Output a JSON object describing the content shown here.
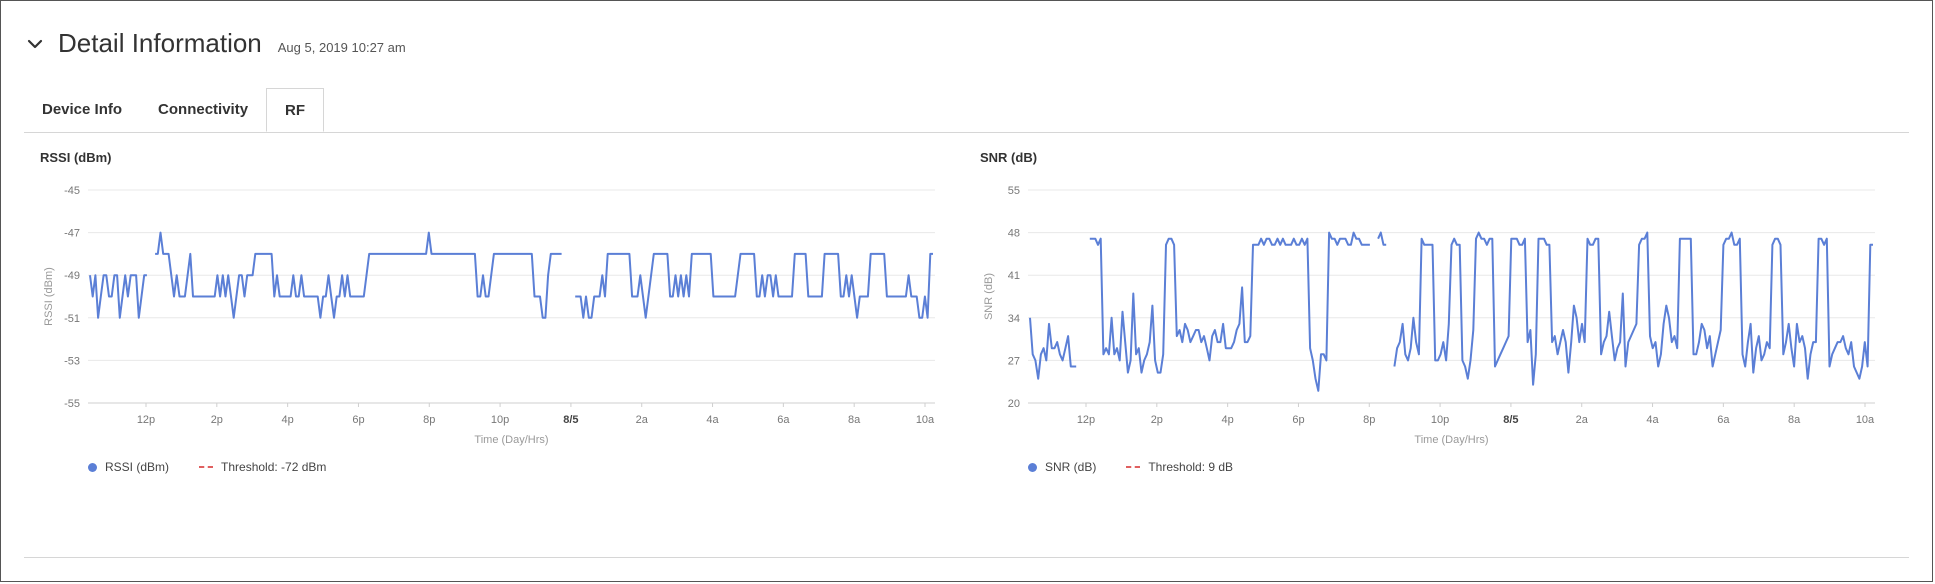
{
  "header": {
    "title": "Detail Information",
    "timestamp": "Aug 5, 2019 10:27 am"
  },
  "tabs": [
    {
      "label": "Device Info",
      "active": false
    },
    {
      "label": "Connectivity",
      "active": false
    },
    {
      "label": "RF",
      "active": true
    }
  ],
  "colors": {
    "series": "#5b7fd6",
    "threshold": "#e06060",
    "grid": "#e8e8e8"
  },
  "chart_data": [
    {
      "type": "line",
      "title": "RSSI (dBm)",
      "ylabel": "RSSI (dBm)",
      "xlabel": "Time (Day/Hrs)",
      "ylim": [
        -55,
        -45
      ],
      "yticks": [
        "-45",
        "-47",
        "-49",
        "-51",
        "-53",
        "-55"
      ],
      "xticks": [
        "12p",
        "2p",
        "4p",
        "6p",
        "8p",
        "10p",
        "8/5",
        "2a",
        "4a",
        "6a",
        "8a",
        "10a"
      ],
      "xticks_bold": [
        "8/5"
      ],
      "legend": {
        "series": "RSSI (dBm)",
        "threshold": "Threshold: -72 dBm"
      },
      "series": [
        {
          "name": "RSSI (dBm)",
          "values": [
            -49,
            -50,
            -49,
            -51,
            -50,
            -49,
            -49,
            -50,
            -50,
            -49,
            -49,
            -51,
            -50,
            -49,
            -50,
            -49,
            -49,
            -49,
            -51,
            -50,
            -49,
            -49,
            null,
            null,
            -48,
            -48,
            -47,
            -48,
            -48,
            -48,
            -49,
            -50,
            -49,
            -50,
            -50,
            -50,
            -49,
            -48,
            -50,
            -50,
            -50,
            -50,
            -50,
            -50,
            -50,
            -50,
            -50,
            -49,
            -50,
            -49,
            -50,
            -49,
            -50,
            -51,
            -50,
            -49,
            -49,
            -50,
            -49,
            -49,
            -49,
            -48,
            -48,
            -48,
            -48,
            -48,
            -48,
            -48,
            -50,
            -49,
            -50,
            -50,
            -50,
            -50,
            -50,
            -49,
            -50,
            -50,
            -49,
            -50,
            -50,
            -50,
            -50,
            -50,
            -50,
            -51,
            -50,
            -50,
            -49,
            -50,
            -51,
            -50,
            -50,
            -49,
            -50,
            -49,
            -50,
            -50,
            -50,
            -50,
            -50,
            -50,
            -49,
            -48,
            -48,
            -48,
            -48,
            -48,
            -48,
            -48,
            -48,
            -48,
            -48,
            -48,
            -48,
            -48,
            -48,
            -48,
            -48,
            -48,
            -48,
            -48,
            -48,
            -48,
            -48,
            -47,
            -48,
            -48,
            -48,
            -48,
            -48,
            -48,
            -48,
            -48,
            -48,
            -48,
            -48,
            -48,
            -48,
            -48,
            -48,
            -48,
            -48,
            -50,
            -50,
            -49,
            -50,
            -50,
            -49,
            -48,
            -48,
            -48,
            -48,
            -48,
            -48,
            -48,
            -48,
            -48,
            -48,
            -48,
            -48,
            -48,
            -48,
            -48,
            -50,
            -50,
            -50,
            -51,
            -51,
            -49,
            -48,
            -48,
            -48,
            -48,
            -48,
            null,
            null,
            null,
            null,
            -50,
            -50,
            -50,
            -51,
            -50,
            -51,
            -51,
            -50,
            -50,
            -50,
            -49,
            -50,
            -48,
            -48,
            -48,
            -48,
            -48,
            -48,
            -48,
            -48,
            -48,
            -50,
            -50,
            -50,
            -49,
            -50,
            -51,
            -50,
            -49,
            -48,
            -48,
            -48,
            -48,
            -48,
            -48,
            -50,
            -50,
            -49,
            -50,
            -49,
            -50,
            -49,
            -50,
            -48,
            -48,
            -48,
            -48,
            -48,
            -48,
            -48,
            -48,
            -50,
            -50,
            -50,
            -50,
            -50,
            -50,
            -50,
            -50,
            -50,
            -49,
            -48,
            -48,
            -48,
            -48,
            -48,
            -48,
            -50,
            -50,
            -49,
            -50,
            -49,
            -49,
            -50,
            -49,
            -50,
            -50,
            -50,
            -50,
            -50,
            -50,
            -48,
            -48,
            -48,
            -48,
            -48,
            -50,
            -50,
            -50,
            -50,
            -50,
            -50,
            -48,
            -48,
            -48,
            -48,
            -48,
            -48,
            -50,
            -50,
            -49,
            -50,
            -49,
            -50,
            -51,
            -50,
            -50,
            -50,
            -50,
            -48,
            -48,
            -48,
            -48,
            -48,
            -48,
            -50,
            -50,
            -50,
            -50,
            -50,
            -50,
            -50,
            -50,
            -49,
            -50,
            -50,
            -50,
            -51,
            -51,
            -50,
            -51,
            -48,
            -48
          ]
        }
      ]
    },
    {
      "type": "line",
      "title": "SNR (dB)",
      "ylabel": "SNR (dB)",
      "xlabel": "Time (Day/Hrs)",
      "ylim": [
        20,
        55
      ],
      "yticks": [
        "55",
        "48",
        "41",
        "34",
        "27",
        "20"
      ],
      "xticks": [
        "12p",
        "2p",
        "4p",
        "6p",
        "8p",
        "10p",
        "8/5",
        "2a",
        "4a",
        "6a",
        "8a",
        "10a"
      ],
      "xticks_bold": [
        "8/5"
      ],
      "legend": {
        "series": "SNR (dB)",
        "threshold": "Threshold: 9 dB"
      },
      "series": [
        {
          "name": "SNR (dB)",
          "values": [
            34,
            28,
            27,
            24,
            28,
            29,
            27,
            33,
            29,
            29,
            30,
            28,
            27,
            29,
            31,
            26,
            26,
            26,
            null,
            null,
            null,
            null,
            47,
            47,
            47,
            46,
            47,
            28,
            29,
            28,
            34,
            28,
            29,
            27,
            35,
            30,
            25,
            27,
            38,
            28,
            29,
            25,
            27,
            28,
            30,
            36,
            27,
            25,
            25,
            28,
            46,
            47,
            47,
            46,
            31,
            32,
            30,
            33,
            32,
            30,
            31,
            32,
            32,
            30,
            31,
            29,
            27,
            31,
            32,
            30,
            30,
            33,
            29,
            29,
            29,
            30,
            32,
            33,
            39,
            30,
            30,
            31,
            46,
            46,
            46,
            47,
            46,
            47,
            47,
            46,
            46,
            47,
            46,
            47,
            46,
            46,
            46,
            47,
            46,
            46,
            47,
            46,
            47,
            29,
            27,
            24,
            22,
            28,
            28,
            27,
            48,
            47,
            47,
            46,
            47,
            47,
            47,
            46,
            46,
            48,
            47,
            47,
            46,
            46,
            46,
            46,
            null,
            null,
            47,
            48,
            46,
            46,
            null,
            null,
            26,
            29,
            30,
            33,
            28,
            27,
            29,
            34,
            30,
            28,
            47,
            46,
            46,
            46,
            46,
            27,
            27,
            28,
            30,
            27,
            33,
            46,
            47,
            46,
            46,
            27,
            26,
            24,
            27,
            32,
            47,
            48,
            47,
            47,
            46,
            47,
            47,
            26,
            27,
            28,
            29,
            30,
            31,
            47,
            47,
            47,
            46,
            46,
            47,
            30,
            32,
            23,
            28,
            47,
            47,
            47,
            46,
            46,
            30,
            31,
            28,
            30,
            32,
            30,
            25,
            30,
            36,
            34,
            30,
            33,
            30,
            47,
            46,
            46,
            47,
            47,
            28,
            30,
            31,
            35,
            31,
            27,
            29,
            30,
            38,
            26,
            30,
            31,
            32,
            33,
            46,
            47,
            47,
            48,
            31,
            29,
            30,
            26,
            28,
            33,
            36,
            34,
            30,
            31,
            29,
            47,
            47,
            47,
            47,
            47,
            28,
            28,
            30,
            33,
            32,
            29,
            31,
            26,
            28,
            30,
            32,
            46,
            47,
            47,
            48,
            46,
            46,
            47,
            28,
            26,
            30,
            33,
            25,
            29,
            31,
            27,
            28,
            30,
            29,
            46,
            47,
            47,
            46,
            28,
            30,
            33,
            29,
            26,
            33,
            30,
            31,
            29,
            24,
            28,
            30,
            30,
            47,
            47,
            46,
            47,
            26,
            28,
            29,
            30,
            30,
            31,
            29,
            28,
            30,
            26,
            25,
            24,
            26,
            30,
            26,
            46,
            46
          ]
        }
      ]
    }
  ]
}
